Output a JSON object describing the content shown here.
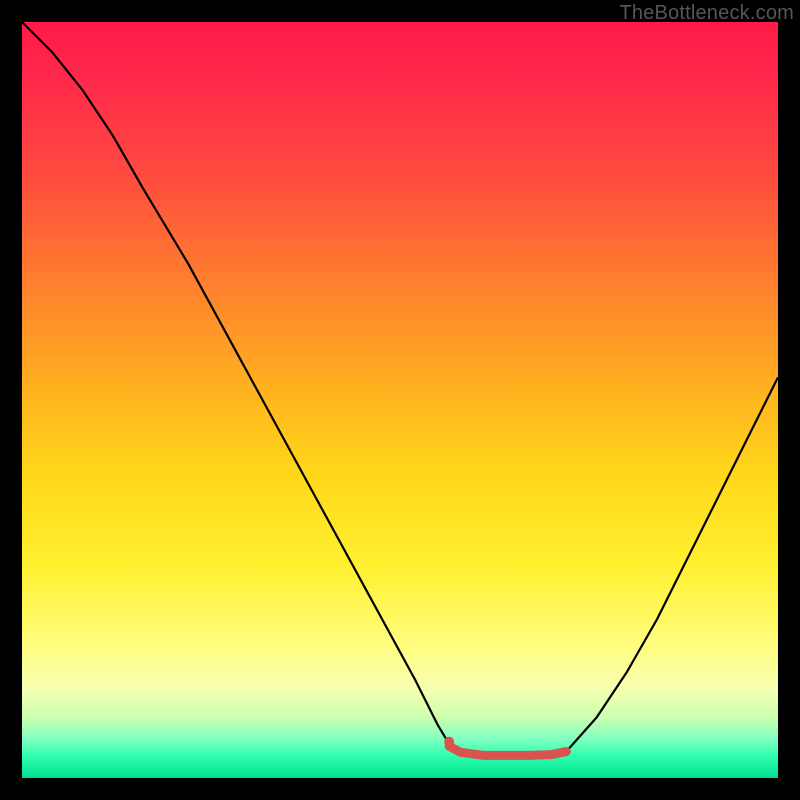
{
  "watermark": "TheBottleneck.com",
  "chart_data": {
    "type": "line",
    "title": "",
    "xlabel": "",
    "ylabel": "",
    "xlim": [
      0,
      100
    ],
    "ylim": [
      0,
      100
    ],
    "gradient_stops": [
      {
        "pct": 0,
        "color": "#ff1a4a"
      },
      {
        "pct": 8,
        "color": "#ff2a4a"
      },
      {
        "pct": 20,
        "color": "#ff4a3f"
      },
      {
        "pct": 33,
        "color": "#ff7a30"
      },
      {
        "pct": 48,
        "color": "#ffb020"
      },
      {
        "pct": 60,
        "color": "#ffd71a"
      },
      {
        "pct": 72,
        "color": "#fff030"
      },
      {
        "pct": 82,
        "color": "#fffd7a"
      },
      {
        "pct": 88,
        "color": "#f7ffb0"
      },
      {
        "pct": 92,
        "color": "#ccffb0"
      },
      {
        "pct": 95,
        "color": "#7affc0"
      },
      {
        "pct": 97,
        "color": "#30ffb0"
      },
      {
        "pct": 100,
        "color": "#00e090"
      }
    ],
    "series": [
      {
        "name": "bottleneck-left",
        "color": "#000000",
        "width": 2.2,
        "x": [
          0,
          4,
          8,
          12,
          16,
          22,
          28,
          34,
          40,
          46,
          52,
          55,
          56.5
        ],
        "y": [
          100,
          96,
          91,
          85,
          78,
          68,
          57,
          46,
          35,
          24,
          13,
          7,
          4.5
        ]
      },
      {
        "name": "bottleneck-right",
        "color": "#000000",
        "width": 2.2,
        "x": [
          72,
          76,
          80,
          84,
          88,
          92,
          96,
          100
        ],
        "y": [
          3.5,
          8,
          14,
          21,
          29,
          37,
          45,
          53
        ]
      },
      {
        "name": "sweet-spot-band",
        "color": "#d9534f",
        "width": 9,
        "cap": "round",
        "x": [
          56.5,
          58,
          61,
          64,
          67,
          70,
          72
        ],
        "y": [
          4.2,
          3.4,
          3.0,
          3.0,
          3.0,
          3.1,
          3.5
        ]
      }
    ],
    "markers": [
      {
        "name": "sweet-spot-start",
        "x": 56.5,
        "y": 4.8,
        "r": 5,
        "color": "#d9534f"
      }
    ]
  }
}
